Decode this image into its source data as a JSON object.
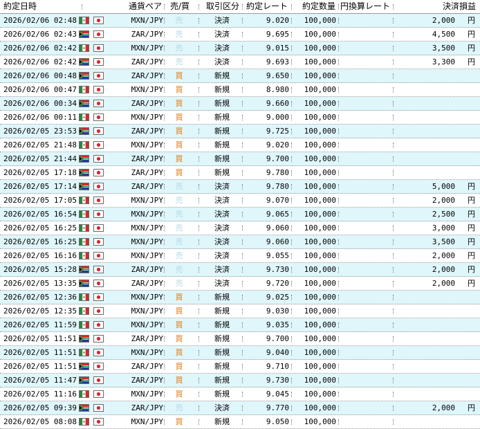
{
  "header": {
    "date": "約定日時",
    "pair": "通貨ペア",
    "side": "売/買",
    "type": "取引区分",
    "rate": "約定レート",
    "qty": "約定数量",
    "jpy_rate": "円換算レート",
    "pnl": "決済損益"
  },
  "colors": {
    "row_alt": "#dff6fb",
    "sell": "#b4d8e6",
    "buy": "#e07a10"
  },
  "rows": [
    {
      "date": "2026/02/06 02:48",
      "flag": "mx",
      "pair": "MXN/JPY",
      "side": "売",
      "type": "決済",
      "rate": "9.020",
      "qty": "100,000",
      "pnl": "2,000",
      "yen": "円"
    },
    {
      "date": "2026/02/06 02:43",
      "flag": "za",
      "pair": "ZAR/JPY",
      "side": "売",
      "type": "決済",
      "rate": "9.695",
      "qty": "100,000",
      "pnl": "4,500",
      "yen": "円"
    },
    {
      "date": "2026/02/06 02:42",
      "flag": "mx",
      "pair": "MXN/JPY",
      "side": "売",
      "type": "決済",
      "rate": "9.015",
      "qty": "100,000",
      "pnl": "3,500",
      "yen": "円"
    },
    {
      "date": "2026/02/06 02:42",
      "flag": "za",
      "pair": "ZAR/JPY",
      "side": "売",
      "type": "決済",
      "rate": "9.693",
      "qty": "100,000",
      "pnl": "3,300",
      "yen": "円"
    },
    {
      "date": "2026/02/06 00:48",
      "flag": "za",
      "pair": "ZAR/JPY",
      "side": "買",
      "type": "新規",
      "rate": "9.650",
      "qty": "100,000",
      "pnl": "",
      "yen": ""
    },
    {
      "date": "2026/02/06 00:47",
      "flag": "mx",
      "pair": "MXN/JPY",
      "side": "買",
      "type": "新規",
      "rate": "8.980",
      "qty": "100,000",
      "pnl": "",
      "yen": ""
    },
    {
      "date": "2026/02/06 00:34",
      "flag": "za",
      "pair": "ZAR/JPY",
      "side": "買",
      "type": "新規",
      "rate": "9.660",
      "qty": "100,000",
      "pnl": "",
      "yen": ""
    },
    {
      "date": "2026/02/06 00:11",
      "flag": "mx",
      "pair": "MXN/JPY",
      "side": "買",
      "type": "新規",
      "rate": "9.000",
      "qty": "100,000",
      "pnl": "",
      "yen": ""
    },
    {
      "date": "2026/02/05 23:53",
      "flag": "za",
      "pair": "ZAR/JPY",
      "side": "買",
      "type": "新規",
      "rate": "9.725",
      "qty": "100,000",
      "pnl": "",
      "yen": ""
    },
    {
      "date": "2026/02/05 21:48",
      "flag": "mx",
      "pair": "MXN/JPY",
      "side": "買",
      "type": "新規",
      "rate": "9.020",
      "qty": "100,000",
      "pnl": "",
      "yen": ""
    },
    {
      "date": "2026/02/05 21:44",
      "flag": "za",
      "pair": "ZAR/JPY",
      "side": "買",
      "type": "新規",
      "rate": "9.700",
      "qty": "100,000",
      "pnl": "",
      "yen": ""
    },
    {
      "date": "2026/02/05 17:18",
      "flag": "za",
      "pair": "ZAR/JPY",
      "side": "買",
      "type": "新規",
      "rate": "9.780",
      "qty": "100,000",
      "pnl": "",
      "yen": ""
    },
    {
      "date": "2026/02/05 17:14",
      "flag": "za",
      "pair": "ZAR/JPY",
      "side": "売",
      "type": "決済",
      "rate": "9.780",
      "qty": "100,000",
      "pnl": "5,000",
      "yen": "円"
    },
    {
      "date": "2026/02/05 17:05",
      "flag": "mx",
      "pair": "MXN/JPY",
      "side": "売",
      "type": "決済",
      "rate": "9.070",
      "qty": "100,000",
      "pnl": "2,000",
      "yen": "円"
    },
    {
      "date": "2026/02/05 16:54",
      "flag": "mx",
      "pair": "MXN/JPY",
      "side": "売",
      "type": "決済",
      "rate": "9.065",
      "qty": "100,000",
      "pnl": "2,500",
      "yen": "円"
    },
    {
      "date": "2026/02/05 16:25",
      "flag": "mx",
      "pair": "MXN/JPY",
      "side": "売",
      "type": "決済",
      "rate": "9.060",
      "qty": "100,000",
      "pnl": "3,000",
      "yen": "円"
    },
    {
      "date": "2026/02/05 16:25",
      "flag": "mx",
      "pair": "MXN/JPY",
      "side": "売",
      "type": "決済",
      "rate": "9.060",
      "qty": "100,000",
      "pnl": "3,500",
      "yen": "円"
    },
    {
      "date": "2026/02/05 16:16",
      "flag": "mx",
      "pair": "MXN/JPY",
      "side": "売",
      "type": "決済",
      "rate": "9.055",
      "qty": "100,000",
      "pnl": "2,000",
      "yen": "円"
    },
    {
      "date": "2026/02/05 15:28",
      "flag": "za",
      "pair": "ZAR/JPY",
      "side": "売",
      "type": "決済",
      "rate": "9.730",
      "qty": "100,000",
      "pnl": "2,000",
      "yen": "円"
    },
    {
      "date": "2026/02/05 13:35",
      "flag": "za",
      "pair": "ZAR/JPY",
      "side": "売",
      "type": "決済",
      "rate": "9.720",
      "qty": "100,000",
      "pnl": "2,000",
      "yen": "円"
    },
    {
      "date": "2026/02/05 12:36",
      "flag": "mx",
      "pair": "MXN/JPY",
      "side": "買",
      "type": "新規",
      "rate": "9.025",
      "qty": "100,000",
      "pnl": "",
      "yen": ""
    },
    {
      "date": "2026/02/05 12:35",
      "flag": "mx",
      "pair": "MXN/JPY",
      "side": "買",
      "type": "新規",
      "rate": "9.030",
      "qty": "100,000",
      "pnl": "",
      "yen": ""
    },
    {
      "date": "2026/02/05 11:59",
      "flag": "mx",
      "pair": "MXN/JPY",
      "side": "買",
      "type": "新規",
      "rate": "9.035",
      "qty": "100,000",
      "pnl": "",
      "yen": ""
    },
    {
      "date": "2026/02/05 11:51",
      "flag": "za",
      "pair": "ZAR/JPY",
      "side": "買",
      "type": "新規",
      "rate": "9.700",
      "qty": "100,000",
      "pnl": "",
      "yen": ""
    },
    {
      "date": "2026/02/05 11:51",
      "flag": "mx",
      "pair": "MXN/JPY",
      "side": "買",
      "type": "新規",
      "rate": "9.040",
      "qty": "100,000",
      "pnl": "",
      "yen": ""
    },
    {
      "date": "2026/02/05 11:51",
      "flag": "za",
      "pair": "ZAR/JPY",
      "side": "買",
      "type": "新規",
      "rate": "9.710",
      "qty": "100,000",
      "pnl": "",
      "yen": ""
    },
    {
      "date": "2026/02/05 11:47",
      "flag": "za",
      "pair": "ZAR/JPY",
      "side": "買",
      "type": "新規",
      "rate": "9.730",
      "qty": "100,000",
      "pnl": "",
      "yen": ""
    },
    {
      "date": "2026/02/05 11:16",
      "flag": "mx",
      "pair": "MXN/JPY",
      "side": "買",
      "type": "新規",
      "rate": "9.045",
      "qty": "100,000",
      "pnl": "",
      "yen": ""
    },
    {
      "date": "2026/02/05 09:39",
      "flag": "za",
      "pair": "ZAR/JPY",
      "side": "売",
      "type": "決済",
      "rate": "9.770",
      "qty": "100,000",
      "pnl": "2,000",
      "yen": "円"
    },
    {
      "date": "2026/02/05 08:08",
      "flag": "mx",
      "pair": "MXN/JPY",
      "side": "買",
      "type": "新規",
      "rate": "9.050",
      "qty": "100,000",
      "pnl": "",
      "yen": ""
    }
  ]
}
